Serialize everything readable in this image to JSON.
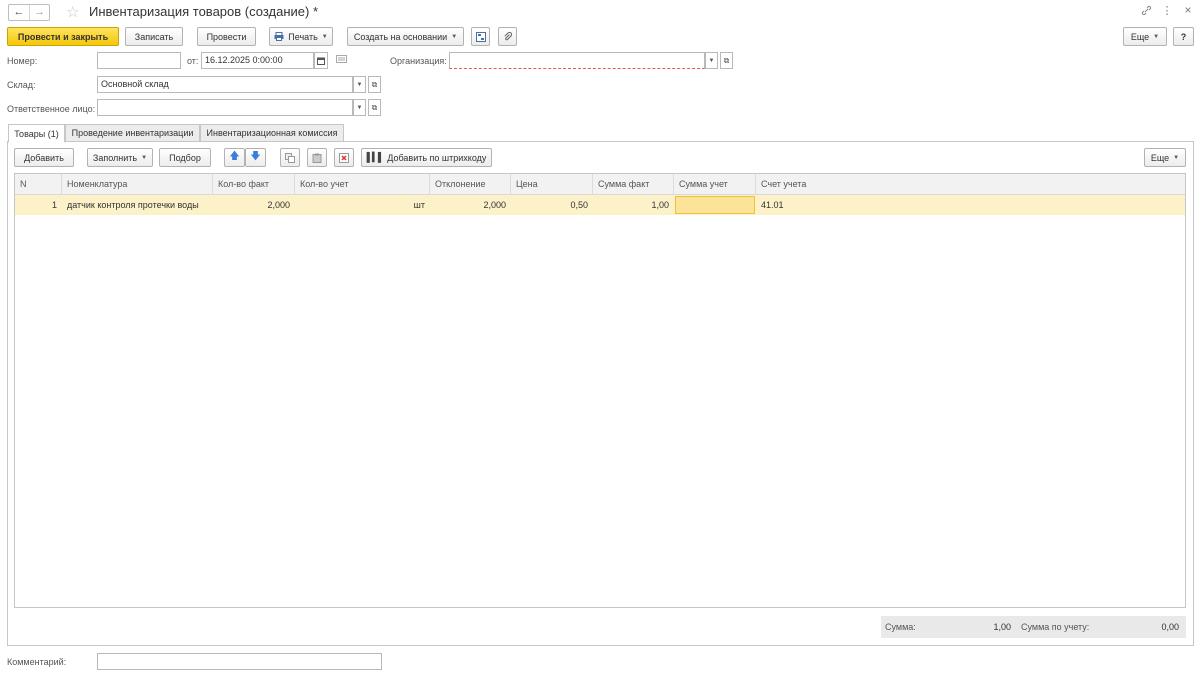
{
  "window": {
    "title": "Инвентаризация товаров (создание) *",
    "back_glyph": "←",
    "forward_glyph": "→",
    "star_glyph": "☆",
    "link_glyph": "🔗",
    "menu_glyph": "⋮",
    "close_glyph": "×"
  },
  "toolbar": {
    "post_close": "Провести и закрыть",
    "save": "Записать",
    "post": "Провести",
    "print": "Печать",
    "create_based": "Создать на основании",
    "more": "Еще",
    "help": "?"
  },
  "form": {
    "number_label": "Номер:",
    "number_value": "",
    "date_label": "от:",
    "date_value": "16.12.2025  0:00:00",
    "org_label": "Организация:",
    "org_value": "",
    "warehouse_label": "Склад:",
    "warehouse_value": "Основной склад",
    "responsible_label": "Ответственное лицо:",
    "responsible_value": "",
    "comment_label": "Комментарий:",
    "comment_value": ""
  },
  "tabs": [
    {
      "label": "Товары (1)",
      "active": true
    },
    {
      "label": "Проведение инвентаризации",
      "active": false
    },
    {
      "label": "Инвентаризационная комиссия",
      "active": false
    }
  ],
  "table_toolbar": {
    "add": "Добавить",
    "fill": "Заполнить",
    "select": "Подбор",
    "barcode": "Добавить по штрихкоду",
    "more": "Еще"
  },
  "table": {
    "columns": [
      "N",
      "Номенклатура",
      "Кол-во факт",
      "Кол-во учет",
      "Отклонение",
      "Цена",
      "Сумма факт",
      "Сумма учет",
      "Счет учета"
    ],
    "rows": [
      {
        "n": "1",
        "item": "датчик контроля протечки воды",
        "qty_fact": "2,000",
        "qty_acc": "",
        "unit": "шт",
        "deviation": "2,000",
        "price": "0,50",
        "sum_fact": "1,00",
        "sum_acc": "",
        "account": "41.01"
      }
    ]
  },
  "totals": {
    "sum_label": "Сумма:",
    "sum_value": "1,00",
    "sum_acc_label": "Сумма по учету:",
    "sum_acc_value": "0,00"
  },
  "colors": {
    "primary_button": "#f3c70b",
    "selected_row": "#fcf1c8",
    "selected_cell": "#fbe39a"
  }
}
